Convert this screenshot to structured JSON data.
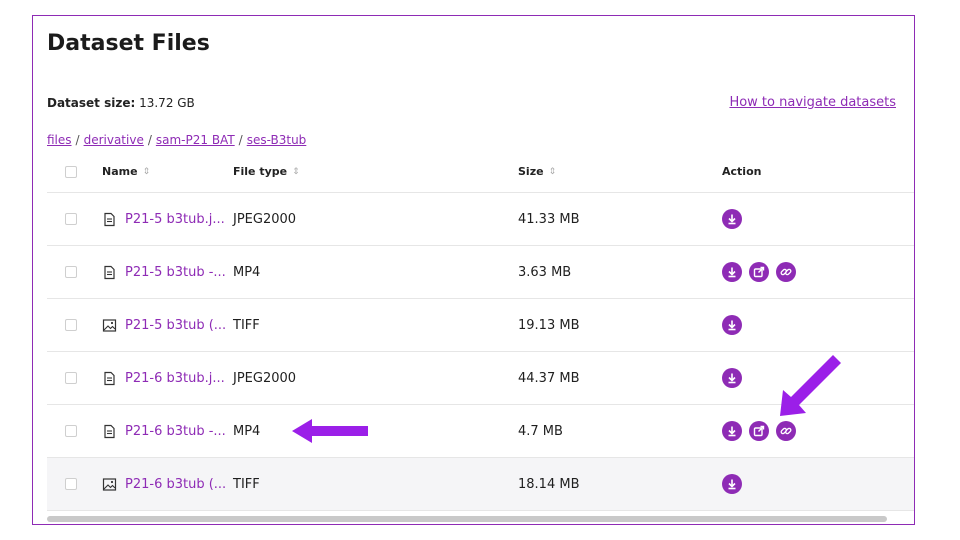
{
  "panel": {
    "title": "Dataset Files",
    "size_label": "Dataset size:",
    "size_value": "13.72 GB",
    "help_link": "How to navigate datasets"
  },
  "breadcrumb": [
    "files",
    "derivative",
    "sam-P21 BAT",
    "ses-B3tub"
  ],
  "table": {
    "columns": {
      "name": "Name",
      "file_type": "File type",
      "size": "Size",
      "action": "Action"
    },
    "rows": [
      {
        "name": "P21-5 b3tub.j...",
        "icon": "document-icon",
        "file_type": "JPEG2000",
        "size": "41.33 MB",
        "actions": [
          "download-icon"
        ]
      },
      {
        "name": "P21-5 b3tub -...",
        "icon": "document-icon",
        "file_type": "MP4",
        "size": "3.63 MB",
        "actions": [
          "download-icon",
          "open-external-icon",
          "link-icon"
        ]
      },
      {
        "name": "P21-5 b3tub (...",
        "icon": "image-icon",
        "file_type": "TIFF",
        "size": "19.13 MB",
        "actions": [
          "download-icon"
        ]
      },
      {
        "name": "P21-6 b3tub.j...",
        "icon": "document-icon",
        "file_type": "JPEG2000",
        "size": "44.37 MB",
        "actions": [
          "download-icon"
        ]
      },
      {
        "name": "P21-6 b3tub -...",
        "icon": "document-icon",
        "file_type": "MP4",
        "size": "4.7 MB",
        "actions": [
          "download-icon",
          "open-external-icon",
          "link-icon"
        ]
      },
      {
        "name": "P21-6 b3tub (...",
        "icon": "image-icon",
        "file_type": "TIFF",
        "size": "18.14 MB",
        "actions": [
          "download-icon"
        ]
      }
    ]
  },
  "colors": {
    "accent": "#8e2bb5",
    "arrow": "#9b1fe8"
  }
}
